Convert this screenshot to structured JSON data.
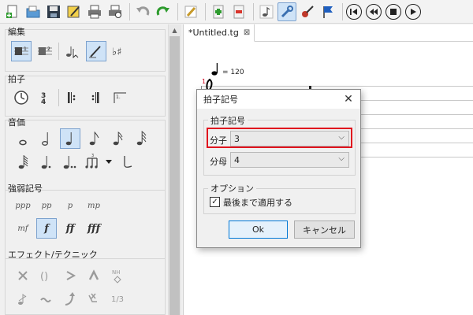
{
  "toolbar": {
    "icons": [
      "new-file-icon",
      "open-file-icon",
      "save-icon",
      "edit-properties-icon",
      "print-icon",
      "print-preview-icon",
      "undo-icon",
      "redo-icon",
      "pencil-icon",
      "add-measure-icon",
      "remove-measure-icon",
      "note-icon",
      "tools-icon",
      "guitar-icon",
      "flag-icon",
      "first-icon",
      "previous-icon",
      "stop-icon",
      "play-icon"
    ]
  },
  "panel": {
    "edit": {
      "title": "編集"
    },
    "time": {
      "title": "拍子"
    },
    "duration": {
      "title": "音価"
    },
    "dynamics": {
      "title": "強弱記号",
      "items": [
        "ppp",
        "pp",
        "p",
        "mp",
        "mf",
        "f",
        "ff",
        "fff"
      ]
    },
    "effects": {
      "title": "エフェクト/テクニック",
      "fraction": "1/3",
      "natural_harmonic": "NH"
    }
  },
  "editor": {
    "tab_title": "*Untitled.tg",
    "tempo": "= 120",
    "measure_number": "1"
  },
  "dialog": {
    "title": "拍子記号",
    "section_time_signature": "拍子記号",
    "numerator_label": "分子",
    "numerator_value": "3",
    "denominator_label": "分母",
    "denominator_value": "4",
    "section_options": "オプション",
    "apply_to_end_label": "最後まで適用する",
    "apply_to_end_checked": true,
    "ok_label": "Ok",
    "cancel_label": "キャンセル"
  },
  "colors": {
    "highlight": "#e0141e",
    "selection": "#cfe3f7",
    "primary_button_border": "#0078d7"
  }
}
